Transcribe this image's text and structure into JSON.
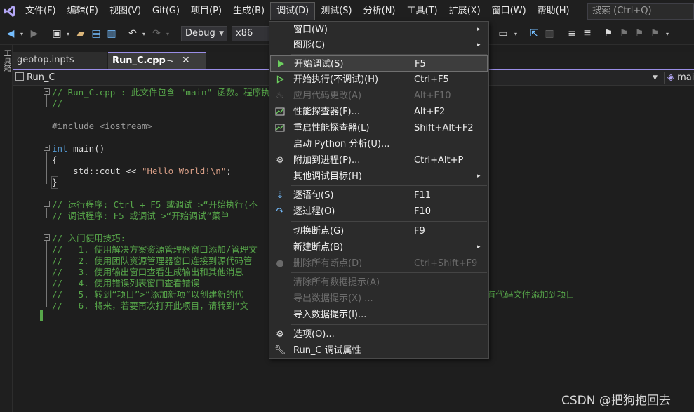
{
  "menubar": {
    "items": [
      "文件(F)",
      "编辑(E)",
      "视图(V)",
      "Git(G)",
      "项目(P)",
      "生成(B)",
      "调试(D)",
      "测试(S)",
      "分析(N)",
      "工具(T)",
      "扩展(X)",
      "窗口(W)",
      "帮助(H)"
    ],
    "search_placeholder": "搜索 (Ctrl+Q)"
  },
  "toolbar": {
    "config": "Debug",
    "platform": "x86"
  },
  "left_strip": {
    "label": "工具箱"
  },
  "tabs": [
    {
      "label": "geotop.inpts"
    },
    {
      "label": "Run_C.cpp"
    }
  ],
  "navbar": {
    "file_scope": "Run_C",
    "member_scope": "mai"
  },
  "code": {
    "l1": "// Run_C.cpp : 此文件包含 \"main\" 函数。程序执",
    "l2": "//",
    "l3": "#include <iostream>",
    "l4_kw": "int",
    "l4_rest": " main()",
    "l5": "{",
    "l6_a": "    std::cout << ",
    "l6_b": "\"Hello World!\\n\"",
    "l6_c": ";",
    "l7": "}",
    "l8": "// 运行程序: Ctrl + F5 或调试 >“开始执行(不",
    "l9": "// 调试程序: F5 或调试 >“开始调试”菜单",
    "l10": "// 入门使用技巧:",
    "l11": "//   1. 使用解决方案资源管理器窗口添加/管理文",
    "l12": "//   2. 使用团队资源管理器窗口连接到源代码管",
    "l13": "//   3. 使用输出窗口查看生成输出和其他消息",
    "l14": "//   4. 使用错误列表窗口查看错误",
    "l15": "//   5. 转到“项目”>“添加新项”以创建新的代",
    "l15_tail": "有代码文件添加到项目",
    "l16": "//   6. 将来，若要再次打开此项目，请转到“文"
  },
  "debug_menu": {
    "items": [
      {
        "label": "窗口(W)",
        "shortcut": "",
        "submenu": "▸"
      },
      {
        "label": "图形(C)",
        "shortcut": "",
        "submenu": "▸"
      },
      {
        "label": "开始调试(S)",
        "shortcut": "F5"
      },
      {
        "label": "开始执行(不调试)(H)",
        "shortcut": "Ctrl+F5"
      },
      {
        "label": "应用代码更改(A)",
        "shortcut": "Alt+F10"
      },
      {
        "label": "性能探查器(F)...",
        "shortcut": "Alt+F2"
      },
      {
        "label": "重启性能探查器(L)",
        "shortcut": "Shift+Alt+F2"
      },
      {
        "label": "启动 Python 分析(U)...",
        "shortcut": ""
      },
      {
        "label": "附加到进程(P)...",
        "shortcut": "Ctrl+Alt+P"
      },
      {
        "label": "其他调试目标(H)",
        "shortcut": "",
        "submenu": "▸"
      },
      {
        "label": "逐语句(S)",
        "shortcut": "F11"
      },
      {
        "label": "逐过程(O)",
        "shortcut": "F10"
      },
      {
        "label": "切换断点(G)",
        "shortcut": "F9"
      },
      {
        "label": "新建断点(B)",
        "shortcut": "",
        "submenu": "▸"
      },
      {
        "label": "删除所有断点(D)",
        "shortcut": "Ctrl+Shift+F9"
      },
      {
        "label": "清除所有数据提示(A)",
        "shortcut": ""
      },
      {
        "label": "导出数据提示(X) ...",
        "shortcut": ""
      },
      {
        "label": "导入数据提示(I)...",
        "shortcut": ""
      },
      {
        "label": "选项(O)...",
        "shortcut": ""
      },
      {
        "label": "Run_C 调试属性",
        "shortcut": ""
      }
    ]
  },
  "watermark": "CSDN @把狗抱回去"
}
